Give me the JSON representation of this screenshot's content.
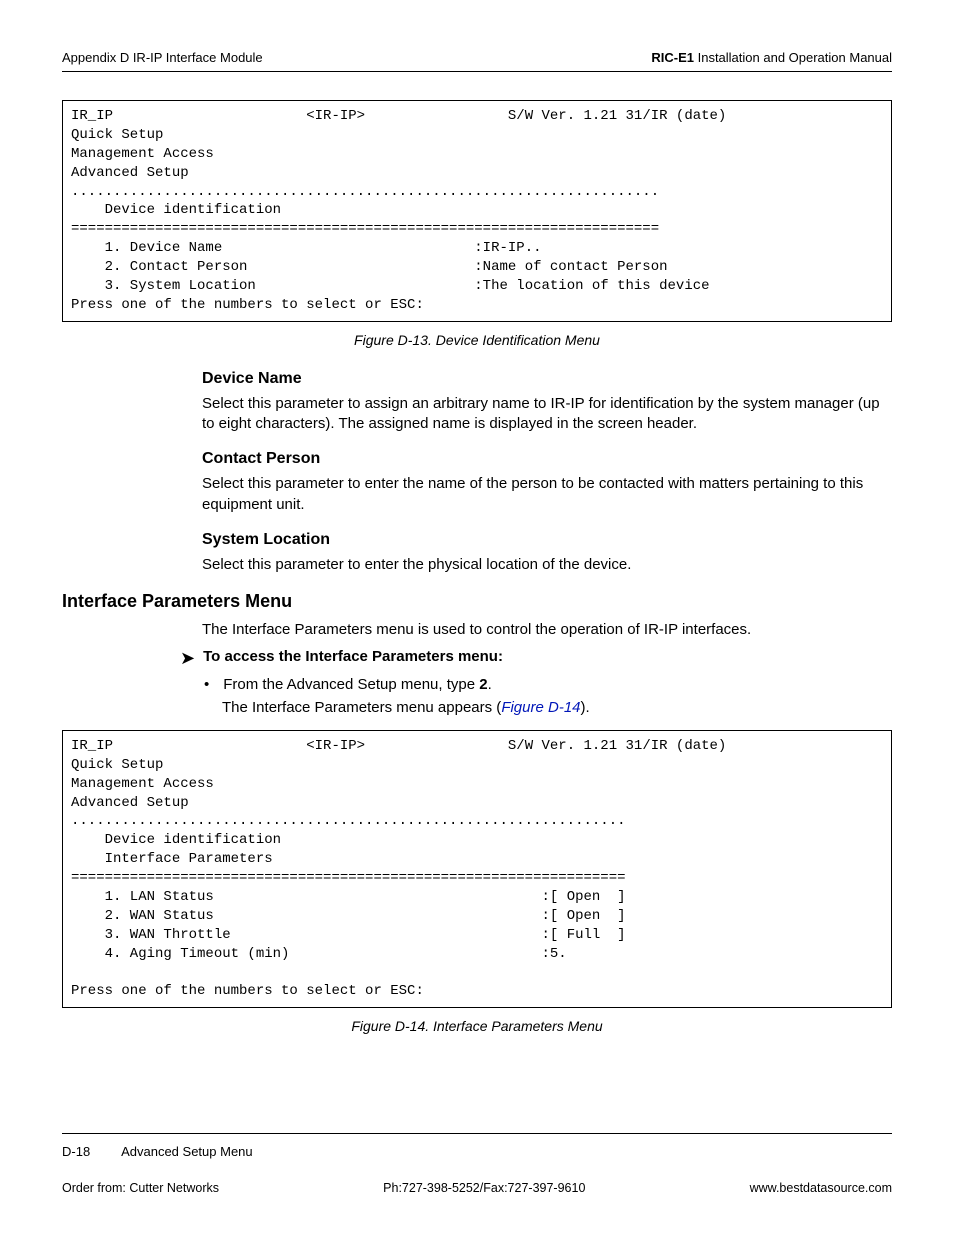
{
  "header": {
    "left": "Appendix D  IR-IP Interface Module",
    "right_bold": "RIC-E1",
    "right_rest": " Installation and Operation Manual"
  },
  "terminal1": {
    "line1_left": "IR_IP",
    "line1_mid": "<IR-IP>",
    "line1_right": "S/W Ver. 1.21 31/IR (date)",
    "menu1": "Quick Setup",
    "menu2": "Management Access",
    "menu3": "Advanced Setup",
    "dots": "......................................................................",
    "submenu": "    Device identification",
    "eqline": "======================================================================",
    "item1_label": "    1. Device Name",
    "item1_val": ":IR-IP..",
    "item2_label": "    2. Contact Person",
    "item2_val": ":Name of contact Person",
    "item3_label": "    3. System Location",
    "item3_val": ":The location of this device",
    "prompt": "Press one of the numbers to select or ESC:"
  },
  "caption1": "Figure D-13.  Device Identification Menu",
  "sec_device_name": {
    "heading": "Device Name",
    "para": "Select this parameter to assign an arbitrary name to IR-IP for identification by the system manager (up to eight characters). The assigned name is displayed in the screen header."
  },
  "sec_contact": {
    "heading": "Contact Person",
    "para": "Select this parameter to enter the name of the person to be contacted with matters pertaining to this equipment unit."
  },
  "sec_location": {
    "heading": "System Location",
    "para": "Select this parameter to enter the physical location of the device."
  },
  "sec_interface": {
    "heading": "Interface Parameters Menu",
    "intro": "The Interface Parameters menu is used to control the operation of IR-IP interfaces.",
    "proc_heading": "To access the Interface Parameters menu:",
    "bullet_pre": "From the Advanced Setup menu, type ",
    "bullet_bold": "2",
    "bullet_post": ".",
    "result_pre": "The Interface Parameters menu appears (",
    "result_xref": "Figure D-14",
    "result_post": ")."
  },
  "terminal2": {
    "line1_left": "IR_IP",
    "line1_mid": "<IR-IP>",
    "line1_right": "S/W Ver. 1.21 31/IR (date)",
    "menu1": "Quick Setup",
    "menu2": "Management Access",
    "menu3": "Advanced Setup",
    "dots": "..................................................................",
    "submenu1": "    Device identification",
    "submenu2": "    Interface Parameters",
    "eqline": "==================================================================",
    "item1_label": "    1. LAN Status",
    "item1_val": ":[ Open  ]",
    "item2_label": "    2. WAN Status",
    "item2_val": ":[ Open  ]",
    "item3_label": "    3. WAN Throttle",
    "item3_val": ":[ Full  ]",
    "item4_label": "    4. Aging Timeout (min)",
    "item4_val": ":5.",
    "prompt": "Press one of the numbers to select or ESC:"
  },
  "caption2": "Figure D-14.  Interface Parameters Menu",
  "footer_top": {
    "page": "D-18",
    "section": "Advanced Setup Menu"
  },
  "footer_bottom": {
    "left": "Order from: Cutter Networks",
    "mid": "Ph:727-398-5252/Fax:727-397-9610",
    "right": "www.bestdatasource.com"
  }
}
